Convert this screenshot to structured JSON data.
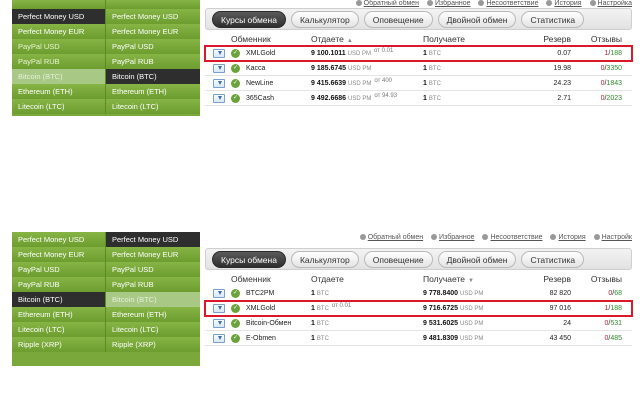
{
  "panel_a": {
    "sidebar": [
      [
        "",
        ""
      ],
      [
        "Perfect Money USD",
        "Perfect Money USD"
      ],
      [
        "Perfect Money EUR",
        "Perfect Money EUR"
      ],
      [
        "PayPal USD",
        "PayPal USD"
      ],
      [
        "PayPal RUB",
        "PayPal RUB"
      ],
      [
        "Bitcoin (BTC)",
        "Bitcoin (BTC)"
      ],
      [
        "Ethereum (ETH)",
        "Ethereum (ETH)"
      ],
      [
        "Litecoin (LTC)",
        "Litecoin (LTC)"
      ]
    ],
    "toplinks": [
      "Обратный обмен",
      "Избранное",
      "Несоответствие",
      "История",
      "Настройка"
    ],
    "tabs": [
      "Курсы обмена",
      "Калькулятор",
      "Оповещение",
      "Двойной обмен",
      "Статистика"
    ],
    "headers": {
      "name": "Обменник",
      "give": "Отдаете",
      "give_sort": "▲",
      "get": "Получаете",
      "reserve": "Резерв",
      "reviews": "Отзывы"
    },
    "rows": [
      {
        "name": "XMLGold",
        "give": "9 100.1011",
        "give_unit": "USD PM",
        "give_min": "от 0.01",
        "get": "1",
        "get_unit": "BTC",
        "reserve": "0.07",
        "rev_a": "1",
        "rev_b": "188"
      },
      {
        "name": "Kacca",
        "give": "9 185.6745",
        "give_unit": "USD PM",
        "give_min": "",
        "get": "1",
        "get_unit": "BTC",
        "reserve": "19.98",
        "rev_a": "0",
        "rev_b": "3350"
      },
      {
        "name": "NewLine",
        "give": "9 415.6639",
        "give_unit": "USD PM",
        "give_min": "от 400",
        "get": "1",
        "get_unit": "BTC",
        "reserve": "24.23",
        "rev_a": "0",
        "rev_b": "1843"
      },
      {
        "name": "365Cash",
        "give": "9 492.6686",
        "give_unit": "USD PM",
        "give_min": "от 94.93",
        "get": "1",
        "get_unit": "BTC",
        "reserve": "2.71",
        "rev_a": "0",
        "rev_b": "2023"
      }
    ]
  },
  "panel_b": {
    "sidebar": [
      [
        "Perfect Money USD",
        "Perfect Money USD"
      ],
      [
        "Perfect Money EUR",
        "Perfect Money EUR"
      ],
      [
        "PayPal USD",
        "PayPal USD"
      ],
      [
        "PayPal RUB",
        "PayPal RUB"
      ],
      [
        "Bitcoin (BTC)",
        "Bitcoin (BTC)"
      ],
      [
        "Ethereum (ETH)",
        "Ethereum (ETH)"
      ],
      [
        "Litecoin (LTC)",
        "Litecoin (LTC)"
      ],
      [
        "Ripple (XRP)",
        "Ripple (XRP)"
      ]
    ],
    "toplinks": [
      "Обратный обмен",
      "Избранное",
      "Несоответствие",
      "История",
      "Настройк"
    ],
    "tabs": [
      "Курсы обмена",
      "Калькулятор",
      "Оповещение",
      "Двойной обмен",
      "Статистика"
    ],
    "headers": {
      "name": "Обменник",
      "give": "Отдаете",
      "get": "Получаете",
      "get_sort": "▼",
      "reserve": "Резерв",
      "reviews": "Отзывы"
    },
    "rows": [
      {
        "name": "BTC2PM",
        "give": "1",
        "give_unit": "BTC",
        "give_min": "",
        "get": "9 778.8400",
        "get_unit": "USD PM",
        "reserve": "82 820",
        "rev_a": "0",
        "rev_b": "68"
      },
      {
        "name": "XMLGold",
        "give": "1",
        "give_unit": "BTC",
        "give_min": "от 0.01",
        "get": "9 716.6725",
        "get_unit": "USD PM",
        "reserve": "97 016",
        "rev_a": "1",
        "rev_b": "188"
      },
      {
        "name": "Bitcoin-Обмен",
        "give": "1",
        "give_unit": "BTC",
        "give_min": "",
        "get": "9 531.6025",
        "get_unit": "USD PM",
        "reserve": "24",
        "rev_a": "0",
        "rev_b": "531"
      },
      {
        "name": "E-Obmen",
        "give": "1",
        "give_unit": "BTC",
        "give_min": "",
        "get": "9 481.8309",
        "get_unit": "USD PM",
        "reserve": "43 450",
        "rev_a": "0",
        "rev_b": "485"
      }
    ]
  },
  "colors": {
    "sidebar_green": "#7aa83a",
    "highlight_red": "#d9182a",
    "review_green": "#2f8a2f",
    "review_red": "#c01c2c"
  }
}
